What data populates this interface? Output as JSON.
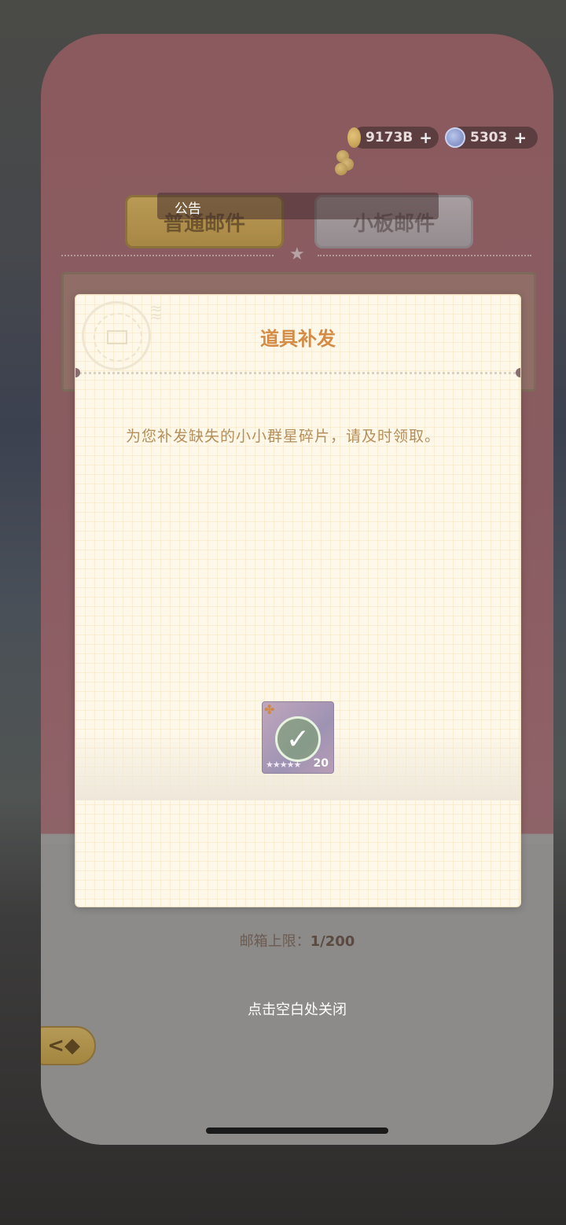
{
  "currency": {
    "coins": "9173B",
    "gems": "5303",
    "plus_symbol": "+"
  },
  "tabs": {
    "announcement": "公告",
    "normal_mail": "普通邮件",
    "board_mail": "小板邮件"
  },
  "dialog": {
    "title": "道具补发",
    "body": "为您补发缺失的小小群星碎片，请及时领取。",
    "reward": {
      "icon": "star-fragment-icon",
      "claimed": true,
      "stars": "★★★★★",
      "count": "20"
    }
  },
  "footer": {
    "mailbox_limit_label": "邮箱上限：",
    "mailbox_limit_value": "1/200",
    "close_hint": "点击空白处关闭",
    "back_symbol": "<◆"
  },
  "colors": {
    "title_accent": "#d38b45",
    "body_text": "#b58e5b",
    "background_tint": "#8a5a5e"
  }
}
